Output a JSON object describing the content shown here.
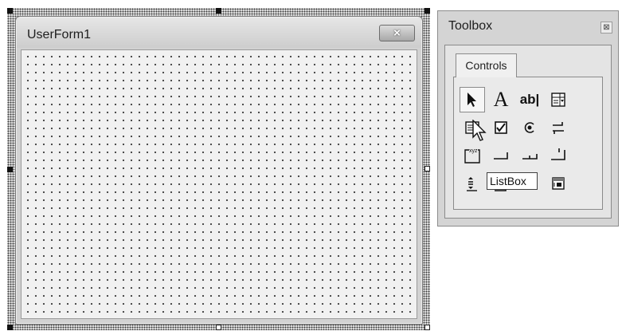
{
  "userform": {
    "title": "UserForm1",
    "close_label": "×"
  },
  "toolbox": {
    "title": "Toolbox",
    "close_label": "⊠",
    "tab_label": "Controls",
    "tools": [
      {
        "icon": "select-objects-icon"
      },
      {
        "icon": "label-icon",
        "glyph": "A"
      },
      {
        "icon": "textbox-icon",
        "glyph": "ab|"
      },
      {
        "icon": "combobox-icon"
      },
      {
        "icon": "listbox-icon"
      },
      {
        "icon": "checkbox-icon"
      },
      {
        "icon": "optionbutton-icon"
      },
      {
        "icon": "togglebutton-icon"
      },
      {
        "icon": "frame-icon",
        "glyph": "xyz"
      },
      {
        "icon": "commandbutton-icon"
      },
      {
        "icon": "tabstrip-icon"
      },
      {
        "icon": "multipage-icon"
      },
      {
        "icon": "scrollbar-icon"
      },
      {
        "icon": "spinbutton-icon"
      },
      {
        "icon": "image-icon"
      },
      {
        "icon": "refedit-icon"
      }
    ],
    "tooltip": "ListBox"
  }
}
